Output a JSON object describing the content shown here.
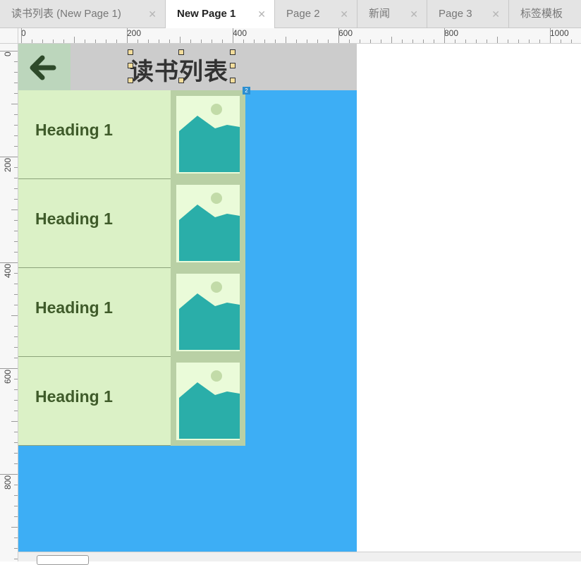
{
  "tabs": [
    {
      "label": "读书列表 (New Page 1)",
      "active": false
    },
    {
      "label": "New Page 1",
      "active": true
    },
    {
      "label": "Page 2",
      "active": false
    },
    {
      "label": "新闻",
      "active": false
    },
    {
      "label": "Page 3",
      "active": false
    },
    {
      "label": "标签模板",
      "active": false
    }
  ],
  "close_glyph": "✕",
  "ruler": {
    "h_labels": [
      "0",
      "200",
      "400",
      "600",
      "800",
      "1000"
    ],
    "v_labels": [
      "0",
      "200",
      "400",
      "600",
      "800"
    ]
  },
  "page": {
    "title": "读书列表",
    "back_icon": "arrow-left-icon",
    "items": [
      {
        "heading": "Heading 1",
        "image_icon": "image-placeholder-icon"
      },
      {
        "heading": "Heading 1",
        "image_icon": "image-placeholder-icon"
      },
      {
        "heading": "Heading 1",
        "image_icon": "image-placeholder-icon"
      },
      {
        "heading": "Heading 1",
        "image_icon": "image-placeholder-icon"
      }
    ]
  },
  "colors": {
    "canvas": "#3daef5",
    "header": "#cccccc",
    "back_button": "#bcd6bc",
    "row_bg": "#dbf1c6",
    "heading_text": "#3f5b2a",
    "image_frame": "#b9d0a5",
    "image_mountain": "#2aaea9"
  },
  "markers": {
    "corner_badge": "2"
  }
}
